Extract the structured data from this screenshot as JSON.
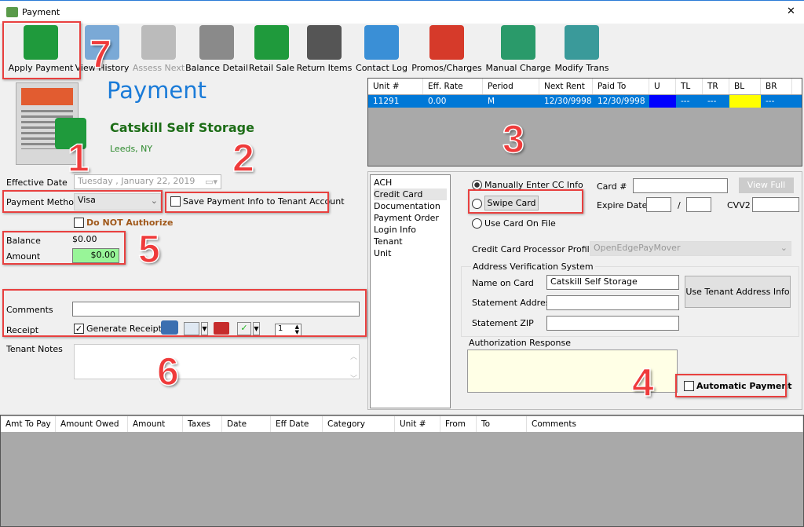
{
  "window": {
    "title": "Payment",
    "close": "✕"
  },
  "toolbar": [
    {
      "label": "Apply Payment",
      "icon": "apply-payment-icon",
      "enabled": true
    },
    {
      "label": "View History",
      "icon": "view-history-icon",
      "enabled": true
    },
    {
      "label": "Assess Next",
      "icon": "assess-next-icon",
      "enabled": false
    },
    {
      "label": "Balance Detail",
      "icon": "balance-detail-icon",
      "enabled": true
    },
    {
      "label": "Retail Sale",
      "icon": "cash-register-icon",
      "enabled": true
    },
    {
      "label": "Return Items",
      "icon": "barcode-return-icon",
      "enabled": true
    },
    {
      "label": "Contact Log",
      "icon": "contact-log-icon",
      "enabled": true
    },
    {
      "label": "Promos/Charges",
      "icon": "promos-charges-icon",
      "enabled": true
    },
    {
      "label": "Manual Charge",
      "icon": "manual-charge-icon",
      "enabled": true
    },
    {
      "label": "Modify Trans",
      "icon": "modify-trans-icon",
      "enabled": true
    }
  ],
  "header": {
    "title": "Payment",
    "company": "Catskill Self Storage",
    "location": "Leeds, NY"
  },
  "form": {
    "effective_date_label": "Effective Date",
    "effective_date": "Tuesday  ,  January   22, 2019",
    "payment_method_label": "Payment Method",
    "payment_method": "Visa",
    "save_payment_info": "Save Payment Info to Tenant Account",
    "do_not_authorize": "Do NOT Authorize",
    "balance_label": "Balance",
    "balance": "$0.00",
    "amount_label": "Amount",
    "amount": "$0.00",
    "comments_label": "Comments",
    "comments": "",
    "receipt_label": "Receipt",
    "generate_receipt": "Generate Receipt",
    "copies": "1",
    "tenant_notes_label": "Tenant Notes"
  },
  "units_grid": {
    "columns": [
      "Unit #",
      "Eff. Rate",
      "Period",
      "Next Rent",
      "Paid To",
      "U",
      "TL",
      "TR",
      "BL",
      "BR"
    ],
    "rows": [
      [
        "11291",
        "0.00",
        "M",
        "12/30/9998",
        "12/30/9998",
        "",
        "---",
        "---",
        "",
        "---"
      ]
    ],
    "colors": {
      "U": "#0000ff",
      "BL": "#ffff00",
      "selected": "#0078d7"
    }
  },
  "methods": [
    "ACH",
    "Credit Card",
    "Documentation",
    "Payment Order",
    "Login Info",
    "Tenant",
    "Unit"
  ],
  "cc": {
    "manual": "Manually Enter CC Info",
    "swipe": "Swipe  Card",
    "on_file": "Use Card On File",
    "card_label": "Card #",
    "view_full": "View Full",
    "expire_label": "Expire Date",
    "slash": "/",
    "cvv_label": "CVV2",
    "processor_label": "Credit Card Processor Profile",
    "processor": "OpenEdgePayMover",
    "avs_label": "Address Verification System",
    "name_label": "Name on Card",
    "name": "Catskill Self Storage",
    "address_label": "Statement Address",
    "zip_label": "Statement ZIP",
    "use_tenant": "Use Tenant Address Info",
    "auth_label": "Authorization Response",
    "automatic": "Automatic Payment"
  },
  "charges_grid": {
    "columns": [
      "Amt To Pay",
      "Amount Owed",
      "Amount",
      "Taxes",
      "Date",
      "Eff Date",
      "Category",
      "Unit #",
      "From",
      "To",
      "Comments"
    ]
  },
  "annotations": [
    "1",
    "2",
    "3",
    "4",
    "5",
    "6",
    "7"
  ]
}
